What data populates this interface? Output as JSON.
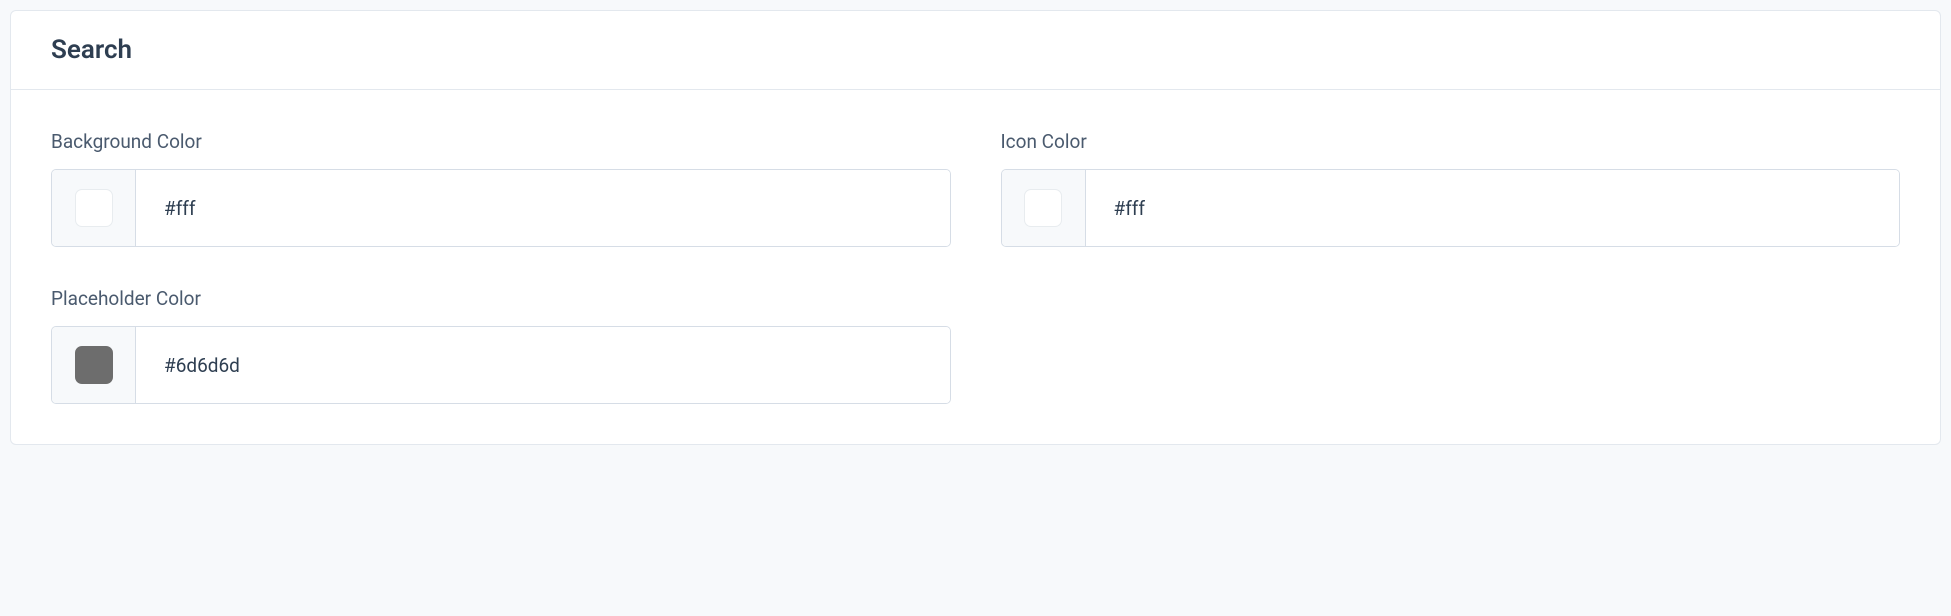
{
  "section": {
    "title": "Search"
  },
  "fields": {
    "background_color": {
      "label": "Background Color",
      "value": "#fff",
      "swatch": "#ffffff",
      "swatch_border": "#e8ecef"
    },
    "icon_color": {
      "label": "Icon Color",
      "value": "#fff",
      "swatch": "#ffffff",
      "swatch_border": "#e8ecef"
    },
    "placeholder_color": {
      "label": "Placeholder Color",
      "value": "#6d6d6d",
      "swatch": "#6d6d6d",
      "swatch_border": "#6d6d6d"
    }
  }
}
